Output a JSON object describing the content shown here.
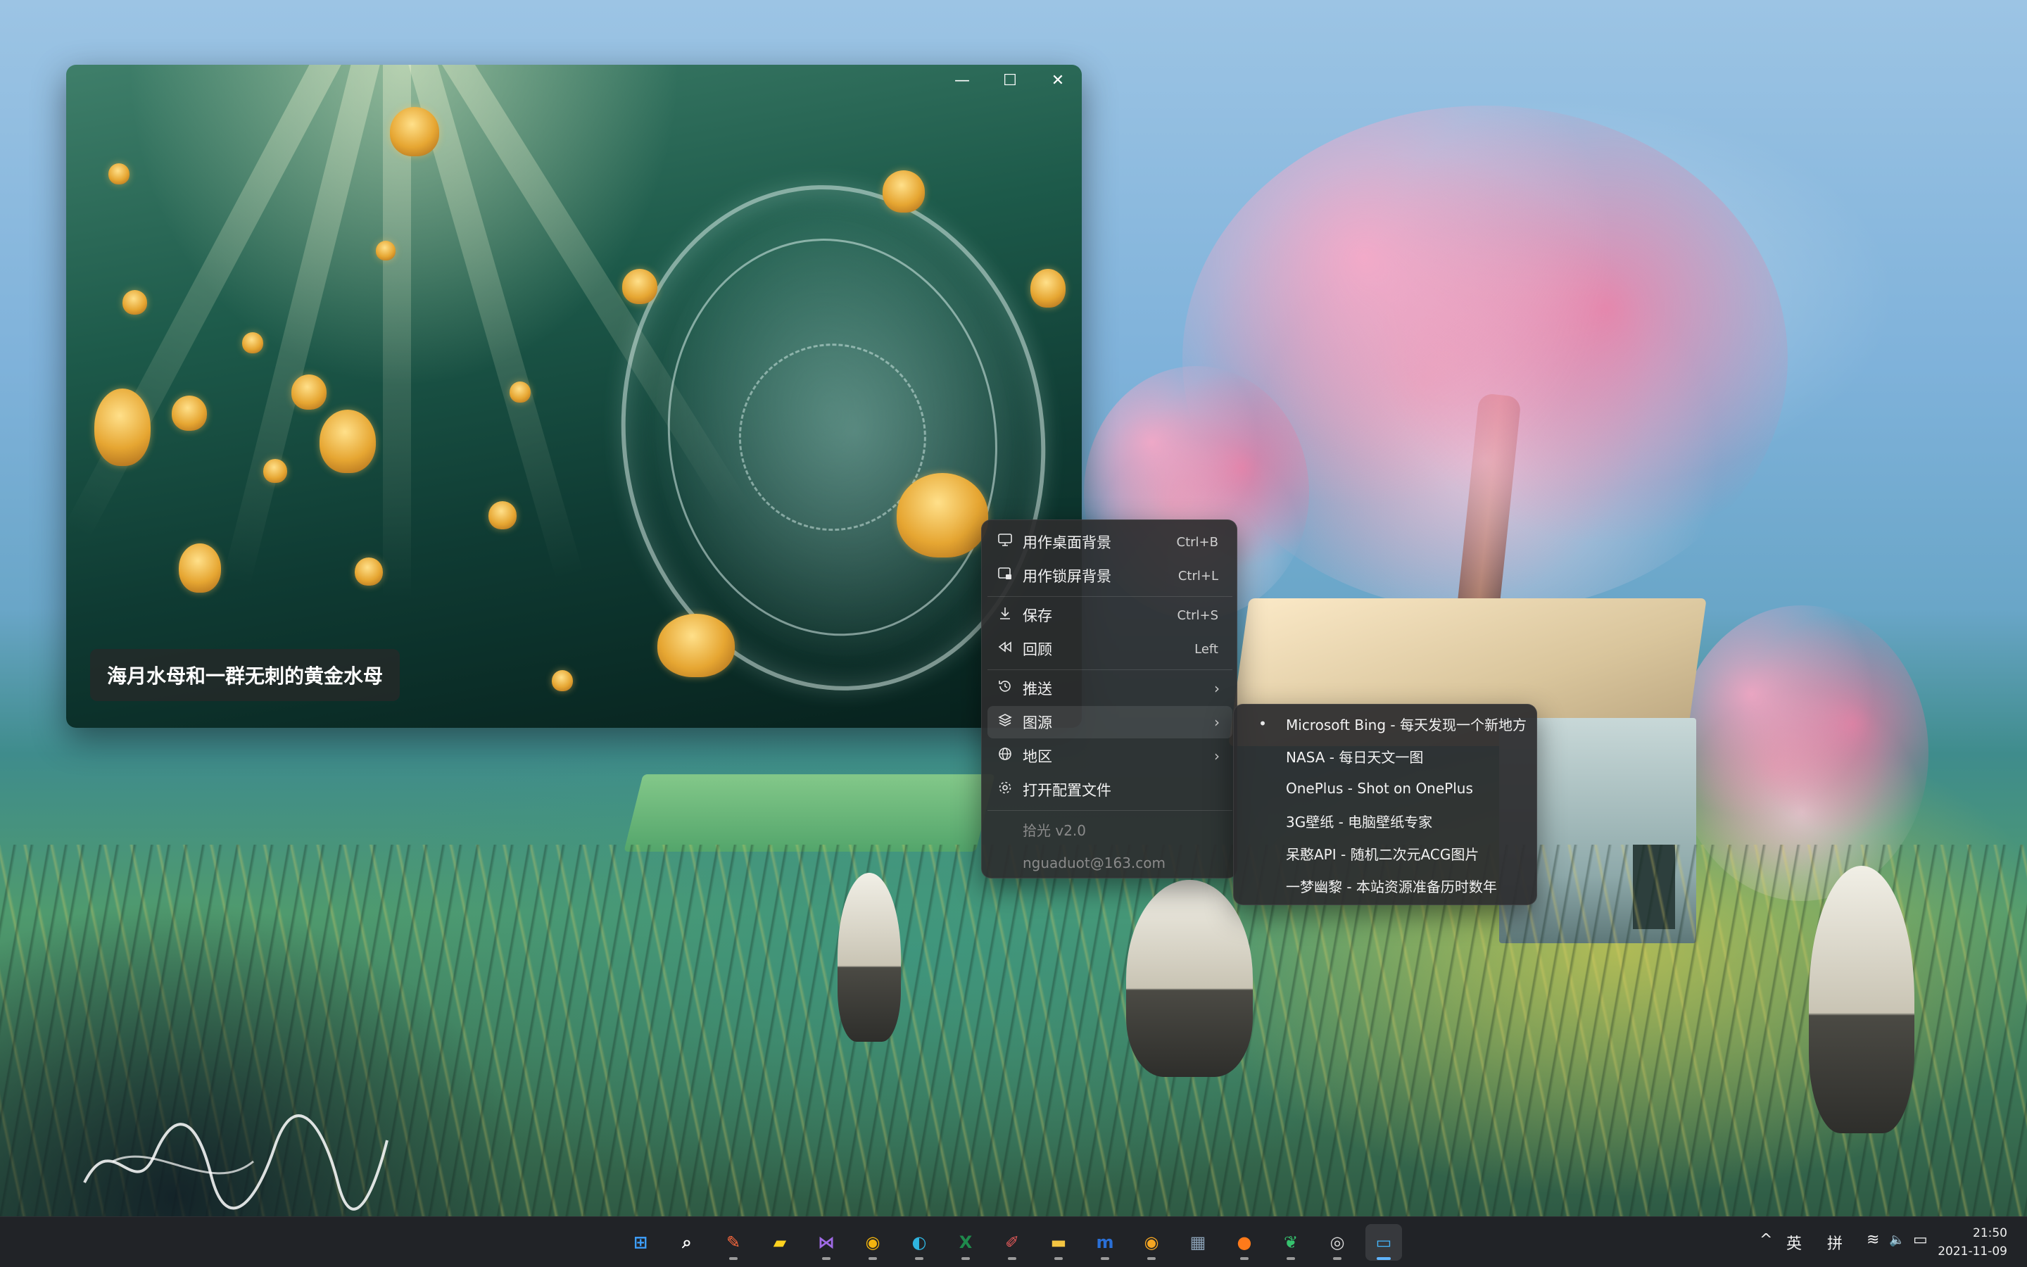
{
  "viewer": {
    "caption": "海月水母和一群无刺的黄金水母",
    "controls": {
      "minimize": "—",
      "maximize": "☐",
      "close": "✕"
    }
  },
  "menu": {
    "items": [
      {
        "label": "用作桌面背景",
        "shortcut": "Ctrl+B",
        "icon": "desktop-icon"
      },
      {
        "label": "用作锁屏背景",
        "shortcut": "Ctrl+L",
        "icon": "lockscreen-icon"
      },
      {
        "label": "保存",
        "shortcut": "Ctrl+S",
        "icon": "download-icon"
      },
      {
        "label": "回顾",
        "shortcut": "Left",
        "icon": "rewind-icon"
      },
      {
        "label": "推送",
        "chevron": "›",
        "icon": "history-icon"
      },
      {
        "label": "图源",
        "chevron": "›",
        "icon": "layers-icon"
      },
      {
        "label": "地区",
        "chevron": "›",
        "icon": "globe-icon"
      },
      {
        "label": "打开配置文件",
        "icon": "gear-icon"
      }
    ],
    "version": "拾光 v2.0",
    "email": "nguaduot@163.com"
  },
  "submenu": {
    "items": [
      {
        "label": "Microsoft Bing - 每天发现一个新地方",
        "selected": true
      },
      {
        "label": "NASA - 每日天文一图"
      },
      {
        "label": "OnePlus - Shot on OnePlus"
      },
      {
        "label": "3G壁纸 - 电脑壁纸专家"
      },
      {
        "label": "呆憨API - 随机二次元ACG图片"
      },
      {
        "label": "一梦幽黎 - 本站资源准备历时数年"
      }
    ],
    "selected_marker": "•"
  },
  "taskbar": {
    "apps": [
      {
        "name": "start-icon",
        "glyph": "⊞",
        "color": "#3ea0ff"
      },
      {
        "name": "search-icon",
        "glyph": "⌕",
        "color": "#ffffff"
      },
      {
        "name": "draw-app-icon",
        "glyph": "✎",
        "color": "#ff6a3d"
      },
      {
        "name": "sticky-notes-icon",
        "glyph": "▰",
        "color": "#ffd21f"
      },
      {
        "name": "visual-studio-icon",
        "glyph": "⋈",
        "color": "#a06be6"
      },
      {
        "name": "chrome-icon",
        "glyph": "◉",
        "color": "#f2b40f"
      },
      {
        "name": "edge-icon",
        "glyph": "◐",
        "color": "#2fb4e0"
      },
      {
        "name": "excel-icon",
        "glyph": "X",
        "color": "#1f8a4c"
      },
      {
        "name": "paint-icon",
        "glyph": "✐",
        "color": "#e45a5a"
      },
      {
        "name": "file-explorer-icon",
        "glyph": "▬",
        "color": "#f4c542"
      },
      {
        "name": "m-app-icon",
        "glyph": "m",
        "color": "#2a6fd6"
      },
      {
        "name": "chrome-canary-icon",
        "glyph": "◉",
        "color": "#f5a623"
      },
      {
        "name": "calculator-icon",
        "glyph": "▦",
        "color": "#8aa0b5"
      },
      {
        "name": "fruit-app-icon",
        "glyph": "●",
        "color": "#ff7a1a"
      },
      {
        "name": "leaf-app-icon",
        "glyph": "❦",
        "color": "#36c26e"
      },
      {
        "name": "media-player-icon",
        "glyph": "◎",
        "color": "#d9d9d9"
      },
      {
        "name": "wallpaper-app-icon",
        "glyph": "▭",
        "color": "#45b8ff"
      }
    ],
    "tray": {
      "chevron": "^",
      "lang": "英",
      "ime": "拼",
      "wifi": "≋",
      "volume": "🔈",
      "battery": "▭"
    },
    "time": "21:50",
    "date": "2021-11-09"
  }
}
